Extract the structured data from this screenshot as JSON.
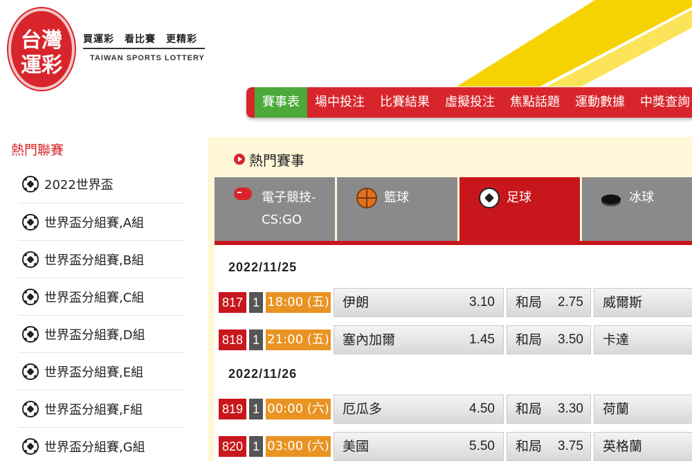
{
  "header": {
    "logo_line1": "台灣",
    "logo_line2": "運彩",
    "tagline": "買運彩　看比賽　更精彩",
    "tagline_en": "TAIWAN SPORTS LOTTERY",
    "accent_color": "#d8252b",
    "stripe_color": "#f5d200"
  },
  "nav": {
    "items": [
      {
        "label": "賽事表",
        "active": true
      },
      {
        "label": "場中投注"
      },
      {
        "label": "比賽結果"
      },
      {
        "label": "虛擬投注"
      },
      {
        "label": "焦點話題"
      },
      {
        "label": "運動數據"
      },
      {
        "label": "中獎查詢"
      }
    ]
  },
  "sidebar": {
    "title": "熱門聯賽",
    "items": [
      {
        "label": "2022世界盃",
        "icon": "soccer-ball-icon"
      },
      {
        "label": "世界盃分組賽,A組",
        "icon": "soccer-ball-icon"
      },
      {
        "label": "世界盃分組賽,B組",
        "icon": "soccer-ball-icon"
      },
      {
        "label": "世界盃分組賽,C組",
        "icon": "soccer-ball-icon"
      },
      {
        "label": "世界盃分組賽,D組",
        "icon": "soccer-ball-icon"
      },
      {
        "label": "世界盃分組賽,E組",
        "icon": "soccer-ball-icon"
      },
      {
        "label": "世界盃分組賽,F組",
        "icon": "soccer-ball-icon"
      },
      {
        "label": "世界盃分組賽,G組",
        "icon": "soccer-ball-icon"
      }
    ]
  },
  "main": {
    "title": "熱門賽事",
    "tabs": [
      {
        "label_line1": "電子競技-",
        "label_line2": "CS:GO",
        "icon": "gamepad-icon"
      },
      {
        "label_line1": "籃球",
        "label_line2": "",
        "icon": "basketball-icon"
      },
      {
        "label_line1": "足球",
        "label_line2": "",
        "icon": "soccer-ball-icon",
        "active": true
      },
      {
        "label_line1": "冰球",
        "label_line2": "",
        "icon": "hockey-puck-icon"
      }
    ],
    "groups": [
      {
        "date": "2022/11/25",
        "matches": [
          {
            "no": "817",
            "type": "1",
            "time": "18:00 (五)",
            "home": "伊朗",
            "home_odd": "3.10",
            "draw": "和局",
            "draw_odd": "2.75",
            "away": "威爾斯"
          },
          {
            "no": "818",
            "type": "1",
            "time": "21:00 (五)",
            "home": "塞內加爾",
            "home_odd": "1.45",
            "draw": "和局",
            "draw_odd": "3.50",
            "away": "卡達"
          }
        ]
      },
      {
        "date": "2022/11/26",
        "matches": [
          {
            "no": "819",
            "type": "1",
            "time": "00:00 (六)",
            "home": "厄瓜多",
            "home_odd": "4.50",
            "draw": "和局",
            "draw_odd": "3.30",
            "away": "荷蘭"
          },
          {
            "no": "820",
            "type": "1",
            "time": "03:00 (六)",
            "home": "美國",
            "home_odd": "5.50",
            "draw": "和局",
            "draw_odd": "3.75",
            "away": "英格蘭"
          }
        ]
      }
    ]
  }
}
